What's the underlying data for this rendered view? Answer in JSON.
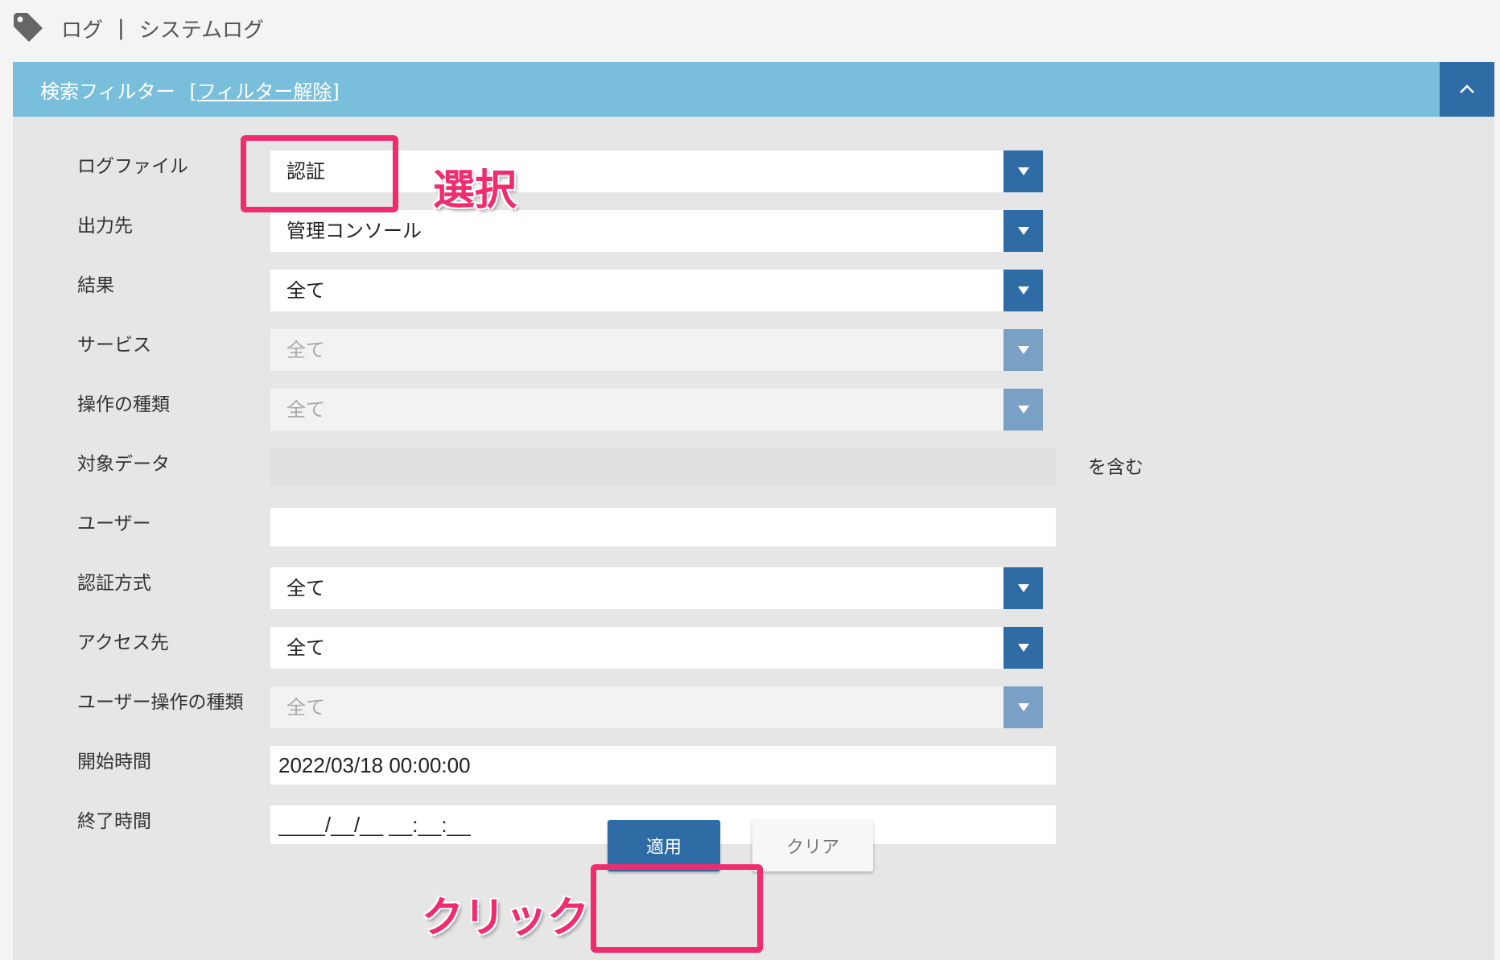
{
  "breadcrumb": {
    "icon": "tag-icon",
    "section": "ログ",
    "separator": "|",
    "page": "システムログ"
  },
  "filter_panel": {
    "title": "検索フィルター",
    "clear_link": "[フィルター解除]",
    "collapse_icon": "chevron-up-icon",
    "header_color": "#79bfdc",
    "accent_color": "#2f6ca5"
  },
  "fields": {
    "log_file": {
      "label": "ログファイル",
      "value": "認証"
    },
    "output": {
      "label": "出力先",
      "value": "管理コンソール"
    },
    "result": {
      "label": "結果",
      "value": "全て"
    },
    "service": {
      "label": "サービス",
      "value": "全て",
      "disabled": true
    },
    "operation_type": {
      "label": "操作の種類",
      "value": "全て",
      "disabled": true
    },
    "target_data": {
      "label": "対象データ",
      "value": "",
      "suffix": "を含む",
      "disabled": true
    },
    "user": {
      "label": "ユーザー",
      "value": ""
    },
    "auth_method": {
      "label": "認証方式",
      "value": "全て"
    },
    "access_target": {
      "label": "アクセス先",
      "value": "全て"
    },
    "user_operation_type": {
      "label": "ユーザー操作の種類",
      "value": "全て",
      "disabled": true
    },
    "start_time": {
      "label": "開始時間",
      "value": "2022/03/18 00:00:00"
    },
    "end_time": {
      "label": "終了時間",
      "value": "____/__/__ __:__:__"
    }
  },
  "buttons": {
    "apply": "適用",
    "clear": "クリア"
  },
  "annotations": {
    "select_note": "選択",
    "click_note": "クリック",
    "highlight_color": "#f02b6e"
  }
}
